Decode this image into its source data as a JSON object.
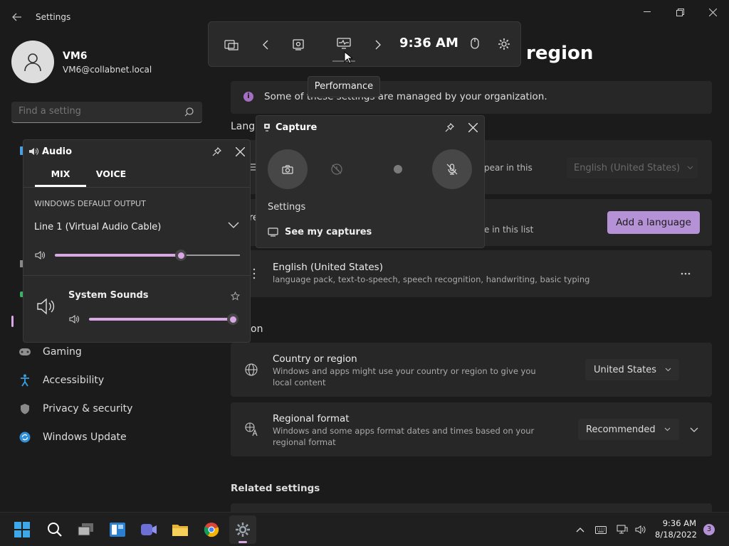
{
  "window": {
    "title": "Settings",
    "minimize_icon": "minimize-icon",
    "maximize_icon": "restore-icon",
    "close_icon": "close-icon"
  },
  "profile": {
    "name": "VM6",
    "email": "VM6@collabnet.local"
  },
  "search": {
    "placeholder": "Find a setting"
  },
  "sidebar": {
    "items": [
      {
        "label": "Gaming",
        "icon": "gaming-icon"
      },
      {
        "label": "Accessibility",
        "icon": "accessibility-icon"
      },
      {
        "label": "Privacy & security",
        "icon": "shield-icon"
      },
      {
        "label": "Windows Update",
        "icon": "update-icon"
      }
    ]
  },
  "page": {
    "title_fragment": "region",
    "org_notice": "Some of these settings are managed by your organization.",
    "lang_section_fragment": "Langu",
    "windows_display_fragment": "pear in this",
    "display_language_value": "English (United States)",
    "preferred_fragment_left": "re",
    "preferred_fragment_right": "e in this list",
    "add_language_label": "Add a language",
    "language_item": {
      "title": "English (United States)",
      "desc": "language pack, text-to-speech, speech recognition, handwriting, basic typing"
    },
    "region_section_fragment": "on",
    "country": {
      "title": "Country or region",
      "desc": "Windows and apps might use your country or region to give you local content",
      "value": "United States"
    },
    "format": {
      "title": "Regional format",
      "desc": "Windows and some apps format dates and times based on your regional format",
      "value": "Recommended"
    },
    "related_title": "Related settings"
  },
  "gamebar": {
    "time": "9:36 AM",
    "tooltip": "Performance"
  },
  "capture": {
    "title": "Capture",
    "settings_label": "Settings",
    "see_captures_label": "See my captures"
  },
  "audio": {
    "title": "Audio",
    "tabs": [
      "MIX",
      "VOICE"
    ],
    "output_header": "WINDOWS DEFAULT OUTPUT",
    "device": "Line 1 (Virtual Audio Cable)",
    "master_volume_fraction": 0.68,
    "app_name": "System Sounds",
    "app_volume_fraction": 1.0
  },
  "taskbar": {
    "time": "9:36 AM",
    "date": "8/18/2022",
    "notification_count": "3"
  },
  "colors": {
    "accent": "#d9a6e6",
    "button": "#b591d6",
    "bg": "#1b1b1b"
  }
}
